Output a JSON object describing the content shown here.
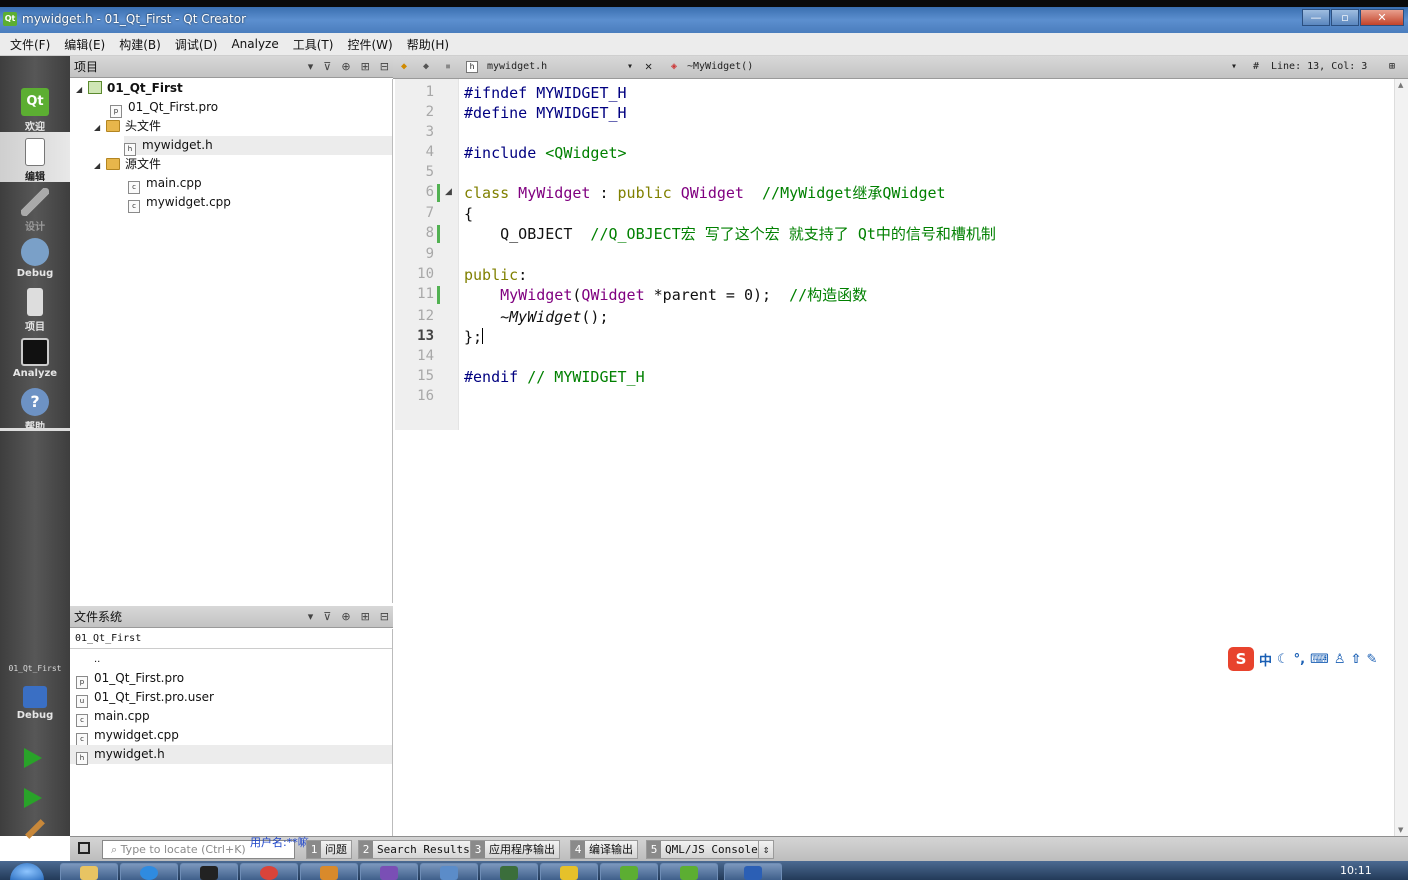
{
  "window": {
    "title": "mywidget.h - 01_Qt_First - Qt Creator",
    "app_icon": "qt-logo-icon"
  },
  "menu": [
    "文件(F)",
    "编辑(E)",
    "构建(B)",
    "调试(D)",
    "Analyze",
    "工具(T)",
    "控件(W)",
    "帮助(H)"
  ],
  "modes": [
    {
      "label": "欢迎",
      "icon": "qt-logo-icon"
    },
    {
      "label": "编辑",
      "icon": "edit-document-icon"
    },
    {
      "label": "设计",
      "icon": "design-pen-icon"
    },
    {
      "label": "Debug",
      "icon": "debug-bug-icon"
    },
    {
      "label": "项目",
      "icon": "project-icon"
    },
    {
      "label": "Analyze",
      "icon": "analyze-icon"
    },
    {
      "label": "帮助",
      "icon": "help-icon"
    }
  ],
  "kit": {
    "project": "01_Qt_First",
    "config": "Debug"
  },
  "project_panel": {
    "title": "项目",
    "tree": [
      {
        "label": "01_Qt_First",
        "kind": "project",
        "bold": true
      },
      {
        "label": "01_Qt_First.pro",
        "kind": "pro"
      },
      {
        "label": "头文件",
        "kind": "folder"
      },
      {
        "label": "mywidget.h",
        "kind": "header",
        "selected": true
      },
      {
        "label": "源文件",
        "kind": "folder"
      },
      {
        "label": "main.cpp",
        "kind": "cpp"
      },
      {
        "label": "mywidget.cpp",
        "kind": "cpp"
      }
    ]
  },
  "filesystem_panel": {
    "title": "文件系统",
    "path": "01_Qt_First",
    "items": [
      "..",
      "01_Qt_First.pro",
      "01_Qt_First.pro.user",
      "main.cpp",
      "mywidget.cpp",
      "mywidget.h"
    ]
  },
  "editor": {
    "file": "mywidget.h",
    "symbol": "~MyWidget()",
    "position": "Line: 13, Col: 3",
    "hash": "#",
    "lines": [
      "1",
      "2",
      "3",
      "4",
      "5",
      "6",
      "7",
      "8",
      "9",
      "10",
      "11",
      "12",
      "13",
      "14",
      "15",
      "16"
    ],
    "current_line": "13"
  },
  "code": {
    "l1": [
      "#ifndef",
      " MYWIDGET_H"
    ],
    "l2": [
      "#define",
      " MYWIDGET_H"
    ],
    "l4": [
      "#include",
      " <QWidget>"
    ],
    "l6": [
      "class",
      " MyWidget",
      " : ",
      "public",
      " QWidget",
      "  //MyWidget继承QWidget"
    ],
    "l7": "{",
    "l8": [
      "    Q_OBJECT",
      "  //Q_OBJECT宏 写了这个宏 就支持了 Qt中的信号和槽机制"
    ],
    "l10": [
      "public",
      ":"
    ],
    "l11": [
      "    ",
      "MyWidget",
      "(",
      "QWidget",
      " *parent = 0);",
      "  //构造函数"
    ],
    "l12": [
      "    ~",
      "MyWidget",
      "();"
    ],
    "l13": "};",
    "l15": [
      "#endif",
      " // MYWIDGET_H"
    ]
  },
  "statusbar": {
    "locator_placeholder": "Type to locate (Ctrl+K)",
    "tabs": [
      {
        "n": "1",
        "label": "问题"
      },
      {
        "n": "2",
        "label": "Search Results"
      },
      {
        "n": "3",
        "label": "应用程序输出"
      },
      {
        "n": "4",
        "label": "编译输出"
      },
      {
        "n": "5",
        "label": "QML/JS Console"
      }
    ],
    "overlay_text": "用户名:**嘛"
  },
  "ime": {
    "logo": "S",
    "mode": "中"
  },
  "taskbar": {
    "clock": "10:11"
  },
  "colors": {
    "keyword": "#808000",
    "type": "#800080",
    "comment": "#008000",
    "change_marker": "#52b152"
  }
}
